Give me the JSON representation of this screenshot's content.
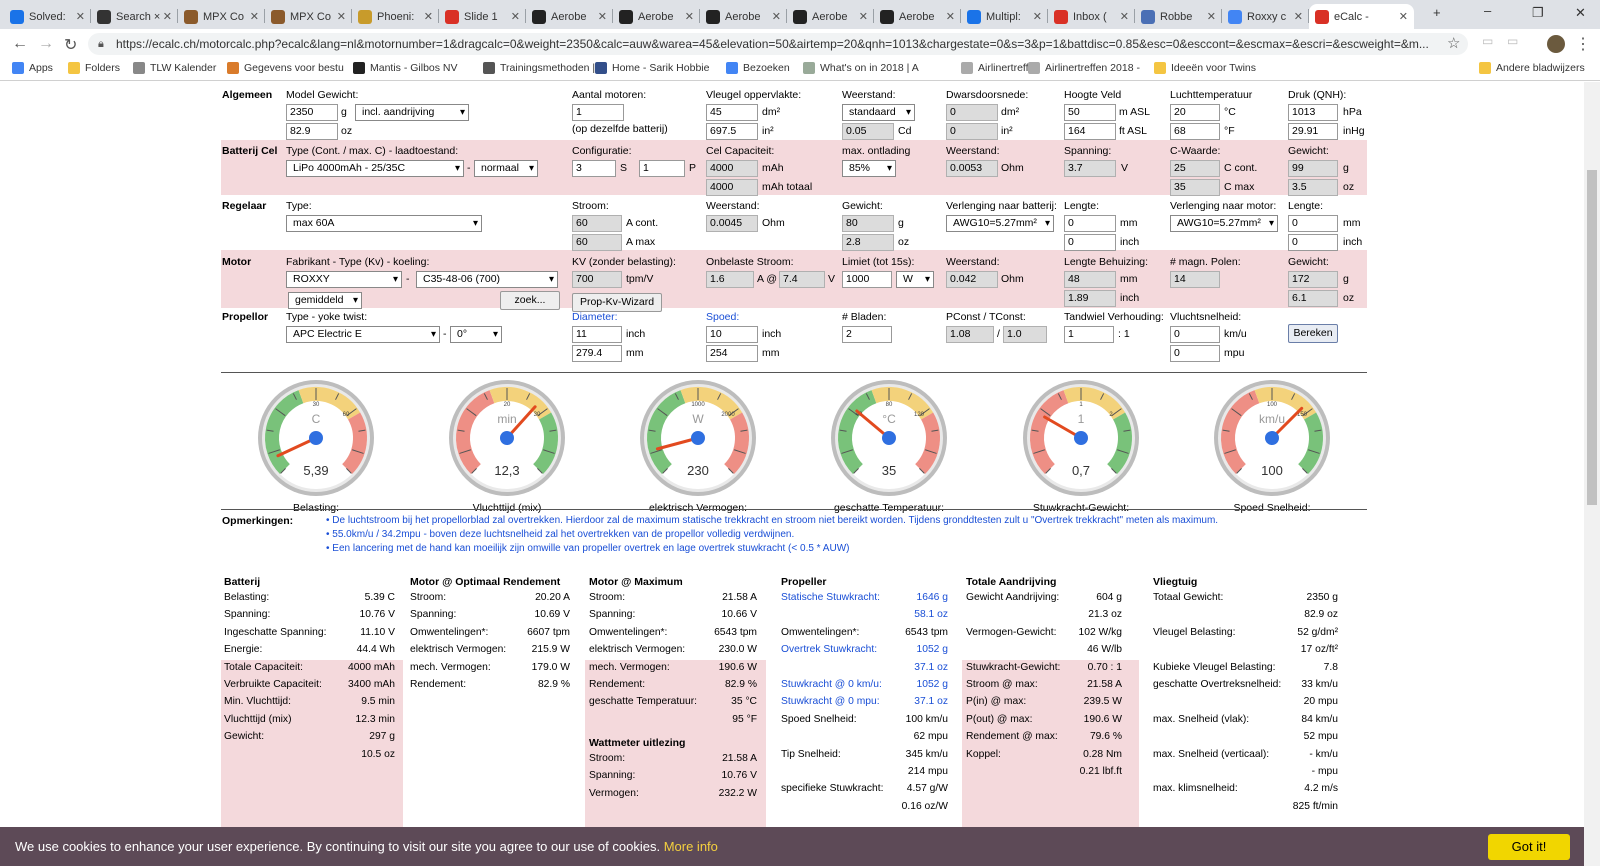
{
  "browser": {
    "tabs": [
      {
        "label": "Solved:",
        "color": "#1a73e8"
      },
      {
        "label": "Search ×",
        "color": "#333"
      },
      {
        "label": "MPX Co",
        "color": "#8b5a2b"
      },
      {
        "label": "MPX Co",
        "color": "#8b5a2b"
      },
      {
        "label": "Phoeni:",
        "color": "#c89b2b"
      },
      {
        "label": "Slide 1",
        "color": "#d93025"
      },
      {
        "label": "Aerobe",
        "color": "#222"
      },
      {
        "label": "Aerobe",
        "color": "#222"
      },
      {
        "label": "Aerobe",
        "color": "#222"
      },
      {
        "label": "Aerobe",
        "color": "#222"
      },
      {
        "label": "Aerobe",
        "color": "#222"
      },
      {
        "label": "Multipl:",
        "color": "#1a73e8"
      },
      {
        "label": "Inbox (",
        "color": "#d93025"
      },
      {
        "label": "Robbe",
        "color": "#4a6fb5"
      },
      {
        "label": "Roxxy c",
        "color": "#4285f4"
      },
      {
        "label": "eCalc -",
        "color": "#d93025"
      }
    ],
    "new_tab": "+",
    "url": "https://ecalc.ch/motorcalc.php?ecalc&lang=nl&motornumber=1&dragcalc=0&weight=2350&calc=auw&warea=45&elevation=50&airtemp=20&qnh=1013&chargestate=0&s=3&p=1&battdisc=0.85&esc=0&esccont=&escmax=&escri=&escweight=&m...",
    "bookmarks": [
      {
        "label": "Apps"
      },
      {
        "label": "Folders"
      },
      {
        "label": "TLW Kalender"
      },
      {
        "label": "Gegevens voor bestu"
      },
      {
        "label": "Mantis - Gilbos NV"
      },
      {
        "label": "Trainingsmethoden |"
      },
      {
        "label": "Home - Sarik Hobbie"
      },
      {
        "label": "Bezoeken"
      },
      {
        "label": "What's on in 2018 | A"
      },
      {
        "label": "Airlinertreffen"
      },
      {
        "label": "Airlinertreffen 2018 -"
      },
      {
        "label": "Ideeën voor Twins"
      },
      {
        "label": "Andere bladwijzers"
      }
    ]
  },
  "form": {
    "algemeen": {
      "title": "Algemeen",
      "model_label": "Model Gewicht:",
      "weight_g": "2350",
      "unit_g": "g",
      "weight_oz": "82.9",
      "unit_oz": "oz",
      "incl": "incl. aandrijving",
      "motors_label": "Aantal motoren:",
      "motors": "1",
      "motors_note": "(op dezelfde batterij)",
      "wing_label": "Vleugel oppervlakte:",
      "wing_dm": "45",
      "unit_dm2": "dm²",
      "wing_in": "697.5",
      "unit_in2": "in²",
      "res_label": "Weerstand:",
      "res_sel": "standaard",
      "cd": "0.05",
      "unit_cd": "Cd",
      "cross_label": "Dwarsdoorsnede:",
      "cross_dm": "0",
      "cross_in": "0",
      "elev_label": "Hoogte Veld",
      "elev_m": "50",
      "unit_m": "m ASL",
      "elev_ft": "164",
      "unit_ft": "ft ASL",
      "temp_label": "Luchttemperatuur",
      "temp_c": "20",
      "unit_c": "°C",
      "temp_f": "68",
      "unit_f": "°F",
      "qnh_label": "Druk (QNH):",
      "qnh_hpa": "1013",
      "unit_hpa": "hPa",
      "qnh_inhg": "29.91",
      "unit_inhg": "inHg"
    },
    "batterij": {
      "title": "Batterij Cel",
      "type_label": "Type (Cont. / max. C) - laadtoestand:",
      "type": "LiPo 4000mAh - 25/35C",
      "state": "normaal",
      "config_label": "Configuratie:",
      "s": "3",
      "unit_s": "S",
      "p": "1",
      "unit_p": "P",
      "cap_label": "Cel Capaciteit:",
      "cap": "4000",
      "unit_mah": "mAh",
      "cap_total": "4000",
      "unit_mah_total": "mAh totaal",
      "disch_label": "max. ontlading",
      "disch": "85%",
      "res_label": "Weerstand:",
      "res": "0.0053",
      "unit_ohm": "Ohm",
      "volt_label": "Spanning:",
      "volt": "3.7",
      "unit_v": "V",
      "c_label": "C-Waarde:",
      "c_cont": "25",
      "unit_ccont": "C cont.",
      "c_max": "35",
      "unit_cmax": "C max",
      "w_label": "Gewicht:",
      "w_g": "99",
      "unit_g": "g",
      "w_oz": "3.5",
      "unit_oz": "oz"
    },
    "regelaar": {
      "title": "Regelaar",
      "type_label": "Type:",
      "type": "max 60A",
      "cur_label": "Stroom:",
      "cur_cont": "60",
      "unit_acont": "A cont.",
      "cur_max": "60",
      "unit_amax": "A max",
      "res_label": "Weerstand:",
      "res": "0.0045",
      "unit_ohm": "Ohm",
      "w_label": "Gewicht:",
      "w_g": "80",
      "unit_g": "g",
      "w_oz": "2.8",
      "unit_oz": "oz",
      "ext_bat_label": "Verlenging naar batterij:",
      "ext_bat": "AWG10=5.27mm²",
      "len_label": "Lengte:",
      "len1": "0",
      "unit_mm": "mm",
      "len1b": "0",
      "unit_inch": "inch",
      "ext_mot_label": "Verlenging naar motor:",
      "ext_mot": "AWG10=5.27mm²",
      "len2_label": "Lengte:",
      "len2": "0",
      "len2b": "0"
    },
    "motor": {
      "title": "Motor",
      "fab_label": "Fabrikant - Type (Kv) - koeling:",
      "fab": "ROXXY",
      "type": "C35-48-06 (700)",
      "cool": "gemiddeld",
      "search": "zoek...",
      "kv_label": "KV (zonder belasting):",
      "kv": "700",
      "unit_kv": "tpm/V",
      "wizard": "Prop-Kv-Wizard",
      "noload_label": "Onbelaste Stroom:",
      "noload_a": "1.6",
      "unit_a_at": "A @",
      "noload_v": "7.4",
      "unit_v": "V",
      "limit_label": "Limiet (tot 15s):",
      "limit": "1000",
      "limit_unit": "W",
      "res_label": "Weerstand:",
      "res": "0.042",
      "unit_ohm": "Ohm",
      "len_label": "Lengte Behuizing:",
      "len_mm": "48",
      "unit_mm": "mm",
      "len_in": "1.89",
      "unit_inch": "inch",
      "poles_label": "# magn. Polen:",
      "poles": "14",
      "w_label": "Gewicht:",
      "w_g": "172",
      "unit_g": "g",
      "w_oz": "6.1",
      "unit_oz": "oz"
    },
    "propellor": {
      "title": "Propellor",
      "type_label": "Type - yoke twist:",
      "type": "APC Electric E",
      "twist": "0°",
      "dia_label": "Diameter:",
      "dia_in": "11",
      "unit_inch": "inch",
      "dia_mm": "279.4",
      "unit_mm": "mm",
      "pitch_label": "Spoed:",
      "pitch_in": "10",
      "pitch_mm": "254",
      "blades_label": "# Bladen:",
      "blades": "2",
      "pconst_label": "PConst / TConst:",
      "pconst": "1.08",
      "slash": "/",
      "tconst": "1.0",
      "gear_label": "Tandwiel Verhouding:",
      "gear": "1",
      "gear_suffix": ": 1",
      "speed_label": "Vluchtsnelheid:",
      "speed_kmh": "0",
      "unit_kmh": "km/u",
      "speed_mph": "0",
      "unit_mph": "mpu",
      "calc": "Bereken"
    }
  },
  "gauges": [
    {
      "unit": "C",
      "value": "5,39",
      "caption": "Belasting:",
      "ticks": [
        "30",
        "60"
      ]
    },
    {
      "unit": "min",
      "value": "12,3",
      "caption": "Vluchttijd (mix)",
      "ticks": [
        "20",
        "30"
      ]
    },
    {
      "unit": "W",
      "value": "230",
      "caption": "elektrisch Vermogen:",
      "ticks": [
        "1000",
        "2000"
      ]
    },
    {
      "unit": "°C",
      "value": "35",
      "caption": "geschatte Temperatuur:",
      "ticks": [
        "80",
        "120",
        "40"
      ]
    },
    {
      "unit": "1",
      "value": "0,7",
      "caption": "Stuwkracht-Gewicht:",
      "ticks": [
        "1",
        "2"
      ]
    },
    {
      "unit": "km/u",
      "value": "100",
      "caption": "Spoed Snelheid:",
      "ticks": [
        "100",
        "150"
      ]
    }
  ],
  "remarks": {
    "label": "Opmerkingen:",
    "items": [
      "De luchtstroom bij het propellorblad zal overtrekken. Hierdoor zal de maximum statische trekkracht en stroom niet bereikt worden. Tijdens gronddtesten zult u \"Overtrek trekkracht\" meten als maximum.",
      "55.0km/u / 34.2mpu - boven deze luchtsnelheid zal het overtrekken van de propellor volledig verdwijnen.",
      "Een lancering met de hand kan moeilijk zijn omwille van propeller overtrek en lage overtrek stuwkracht (< 0.5 * AUW)"
    ]
  },
  "results": {
    "batterij": {
      "title": "Batterij",
      "rows": [
        [
          "Belasting:",
          "5.39 C"
        ],
        [
          "Spanning:",
          "10.76 V"
        ],
        [
          "Ingeschatte Spanning:",
          "11.10 V"
        ],
        [
          "Energie:",
          "44.4 Wh"
        ],
        [
          "Totale Capaciteit:",
          "4000 mAh"
        ],
        [
          "Verbruikte Capaciteit:",
          "3400 mAh"
        ],
        [
          "Min. Vluchttijd:",
          "9.5 min"
        ],
        [
          "Vluchttijd (mix)",
          "12.3 min"
        ],
        [
          "Gewicht:",
          "297 g"
        ],
        [
          "",
          "10.5 oz"
        ]
      ]
    },
    "optimaal": {
      "title": "Motor @ Optimaal Rendement",
      "rows": [
        [
          "Stroom:",
          "20.20 A"
        ],
        [
          "Spanning:",
          "10.69 V"
        ],
        [
          "Omwentelingen*:",
          "6607 tpm"
        ],
        [
          "elektrisch Vermogen:",
          "215.9 W"
        ],
        [
          "mech. Vermogen:",
          "179.0 W"
        ],
        [
          "Rendement:",
          "82.9 %"
        ]
      ]
    },
    "maximum": {
      "title": "Motor @ Maximum",
      "rows": [
        [
          "Stroom:",
          "21.58 A"
        ],
        [
          "Spanning:",
          "10.66 V"
        ],
        [
          "Omwentelingen*:",
          "6543 tpm"
        ],
        [
          "elektrisch Vermogen:",
          "230.0 W"
        ],
        [
          "mech. Vermogen:",
          "190.6 W"
        ],
        [
          "Rendement:",
          "82.9 %"
        ],
        [
          "geschatte Temperatuur:",
          "35 °C"
        ],
        [
          "",
          "95 °F"
        ]
      ]
    },
    "wattmeter": {
      "title": "Wattmeter uitlezing",
      "rows": [
        [
          "Stroom:",
          "21.58 A"
        ],
        [
          "Spanning:",
          "10.76 V"
        ],
        [
          "Vermogen:",
          "232.2 W"
        ]
      ]
    },
    "propeller": {
      "title": "Propeller",
      "rows": [
        [
          "Statische Stuwkracht:",
          "1646 g",
          true
        ],
        [
          "",
          "58.1 oz",
          true
        ],
        [
          "Omwentelingen*:",
          "6543 tpm",
          false
        ],
        [
          "Overtrek Stuwkracht:",
          "1052 g",
          true
        ],
        [
          "",
          "37.1 oz",
          true
        ],
        [
          "Stuwkracht @ 0 km/u:",
          "1052 g",
          true
        ],
        [
          "Stuwkracht @ 0 mpu:",
          "37.1 oz",
          true
        ],
        [
          "Spoed Snelheid:",
          "100 km/u",
          false
        ],
        [
          "",
          "62 mpu",
          false
        ],
        [
          "Tip Snelheid:",
          "345 km/u",
          false
        ],
        [
          "",
          "214 mpu",
          false
        ],
        [
          "specifieke Stuwkracht:",
          "4.57 g/W",
          false
        ],
        [
          "",
          "0.16 oz/W",
          false
        ]
      ]
    },
    "totale": {
      "title": "Totale Aandrijving",
      "rows": [
        [
          "Gewicht Aandrijving:",
          "604 g"
        ],
        [
          "",
          "21.3 oz"
        ],
        [
          "Vermogen-Gewicht:",
          "102 W/kg"
        ],
        [
          "",
          "46 W/lb"
        ],
        [
          "Stuwkracht-Gewicht:",
          "0.70 : 1"
        ],
        [
          "Stroom @ max:",
          "21.58 A"
        ],
        [
          "P(in) @ max:",
          "239.5 W"
        ],
        [
          "P(out) @ max:",
          "190.6 W"
        ],
        [
          "Rendement @ max:",
          "79.6 %"
        ],
        [
          "Koppel:",
          "0.28 Nm"
        ],
        [
          "",
          "0.21 lbf.ft"
        ]
      ]
    },
    "vliegtuig": {
      "title": "Vliegtuig",
      "rows": [
        [
          "Totaal Gewicht:",
          "2350 g"
        ],
        [
          "",
          "82.9 oz"
        ],
        [
          "Vleugel Belasting:",
          "52 g/dm²"
        ],
        [
          "",
          "17 oz/ft²"
        ],
        [
          "Kubieke Vleugel Belasting:",
          "7.8"
        ],
        [
          "geschatte Overtreksnelheid:",
          "33 km/u"
        ],
        [
          "",
          "20 mpu"
        ],
        [
          "max. Snelheid (vlak):",
          "84 km/u"
        ],
        [
          "",
          "52 mpu"
        ],
        [
          "max. Snelheid (verticaal):",
          "- km/u"
        ],
        [
          "",
          "- mpu"
        ],
        [
          "max. klimsnelheid:",
          "4.2 m/s"
        ],
        [
          "",
          "825 ft/min"
        ]
      ]
    }
  },
  "cookie": {
    "text": "We use cookies to enhance your user experience. By continuing to visit our site you agree to our use of cookies.",
    "more": "More info",
    "button": "Got it!"
  },
  "colors": {
    "panel": "#f4d9dc",
    "link": "#1a4fd6",
    "cookie_bg": "#5d4a57",
    "cookie_btn": "#f1d600"
  }
}
